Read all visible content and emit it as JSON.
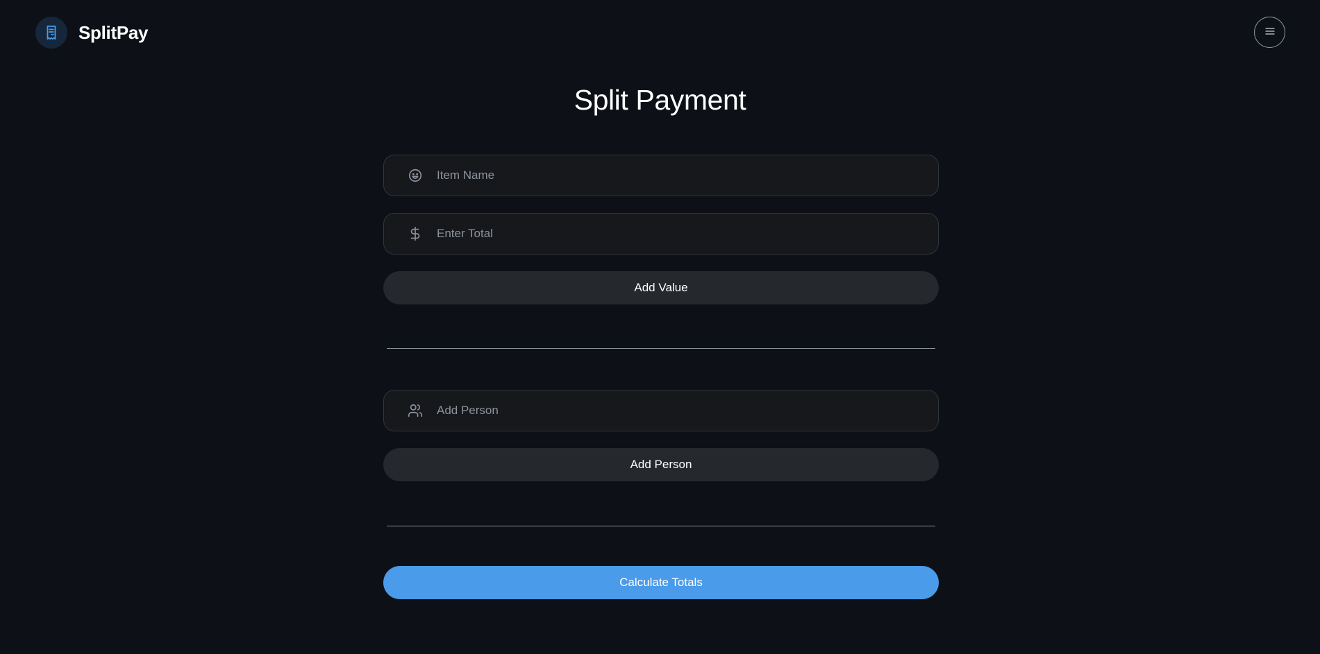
{
  "app": {
    "brand": "SplitPay",
    "brand_icon": "receipt-icon",
    "menu_icon": "hamburger-menu-icon"
  },
  "page": {
    "title": "Split Payment"
  },
  "item_form": {
    "item_name": {
      "placeholder": "Item Name",
      "value": "",
      "icon": "smile-icon"
    },
    "total": {
      "placeholder": "Enter Total",
      "value": "",
      "icon": "dollar-icon"
    },
    "add_value_label": "Add Value"
  },
  "person_form": {
    "person": {
      "placeholder": "Add Person",
      "value": "",
      "icon": "users-icon"
    },
    "add_person_label": "Add Person"
  },
  "actions": {
    "calculate_label": "Calculate Totals"
  },
  "colors": {
    "background": "#0d1117",
    "accent": "#4a9be9",
    "secondary_button": "#25282d",
    "field_background": "#17181c",
    "logo_icon": "#4a9be9"
  }
}
